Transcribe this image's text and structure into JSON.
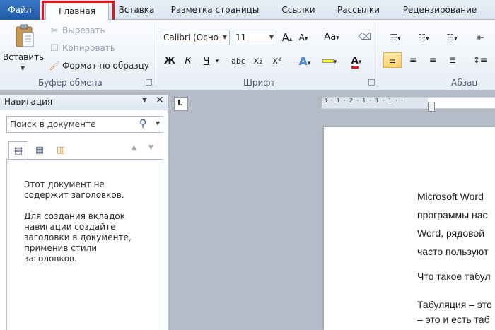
{
  "tabs": {
    "file": "Файл",
    "home": "Главная",
    "insert": "Вставка",
    "page_layout": "Разметка страницы",
    "references": "Ссылки",
    "mailings": "Рассылки",
    "review": "Рецензирование"
  },
  "clipboard": {
    "paste": "Вставить",
    "cut": "Вырезать",
    "copy": "Копировать",
    "format_painter": "Формат по образцу",
    "group_label": "Буфер обмена"
  },
  "font": {
    "name": "Calibri (Осно",
    "size": "11",
    "group_label": "Шрифт",
    "bold": "Ж",
    "italic": "К",
    "underline": "Ч",
    "strike": "abc",
    "subscript": "x₂",
    "superscript": "x²",
    "grow": "A",
    "shrink": "A",
    "case": "Aa"
  },
  "paragraph": {
    "group_label": "Абзац"
  },
  "nav": {
    "title": "Навигация",
    "search_placeholder": "Поиск в документе",
    "message1_line1": "Этот документ не",
    "message1_line2": "содержит заголовков.",
    "message2_line1": "Для создания вкладок",
    "message2_line2": "навигации создайте",
    "message2_line3": "заголовки в документе,",
    "message2_line4": "применив стили",
    "message2_line5": "заголовков."
  },
  "ruler": {
    "ticks": "3 · 1 · 2 · 1 · 1 · 1 · ·",
    "corner": "L"
  },
  "document": {
    "line1": "Microsoft Word",
    "line2": "программы нас",
    "line3": "Word, рядовой",
    "line4": "часто пользуют",
    "line5": "Что такое табул",
    "line6": "Табуляция – это",
    "line7": "– это и есть таб"
  },
  "colors": {
    "file_tab": "#2a6bbf",
    "highlight_box": "#e8141c",
    "active_button": "#ffd56c"
  }
}
